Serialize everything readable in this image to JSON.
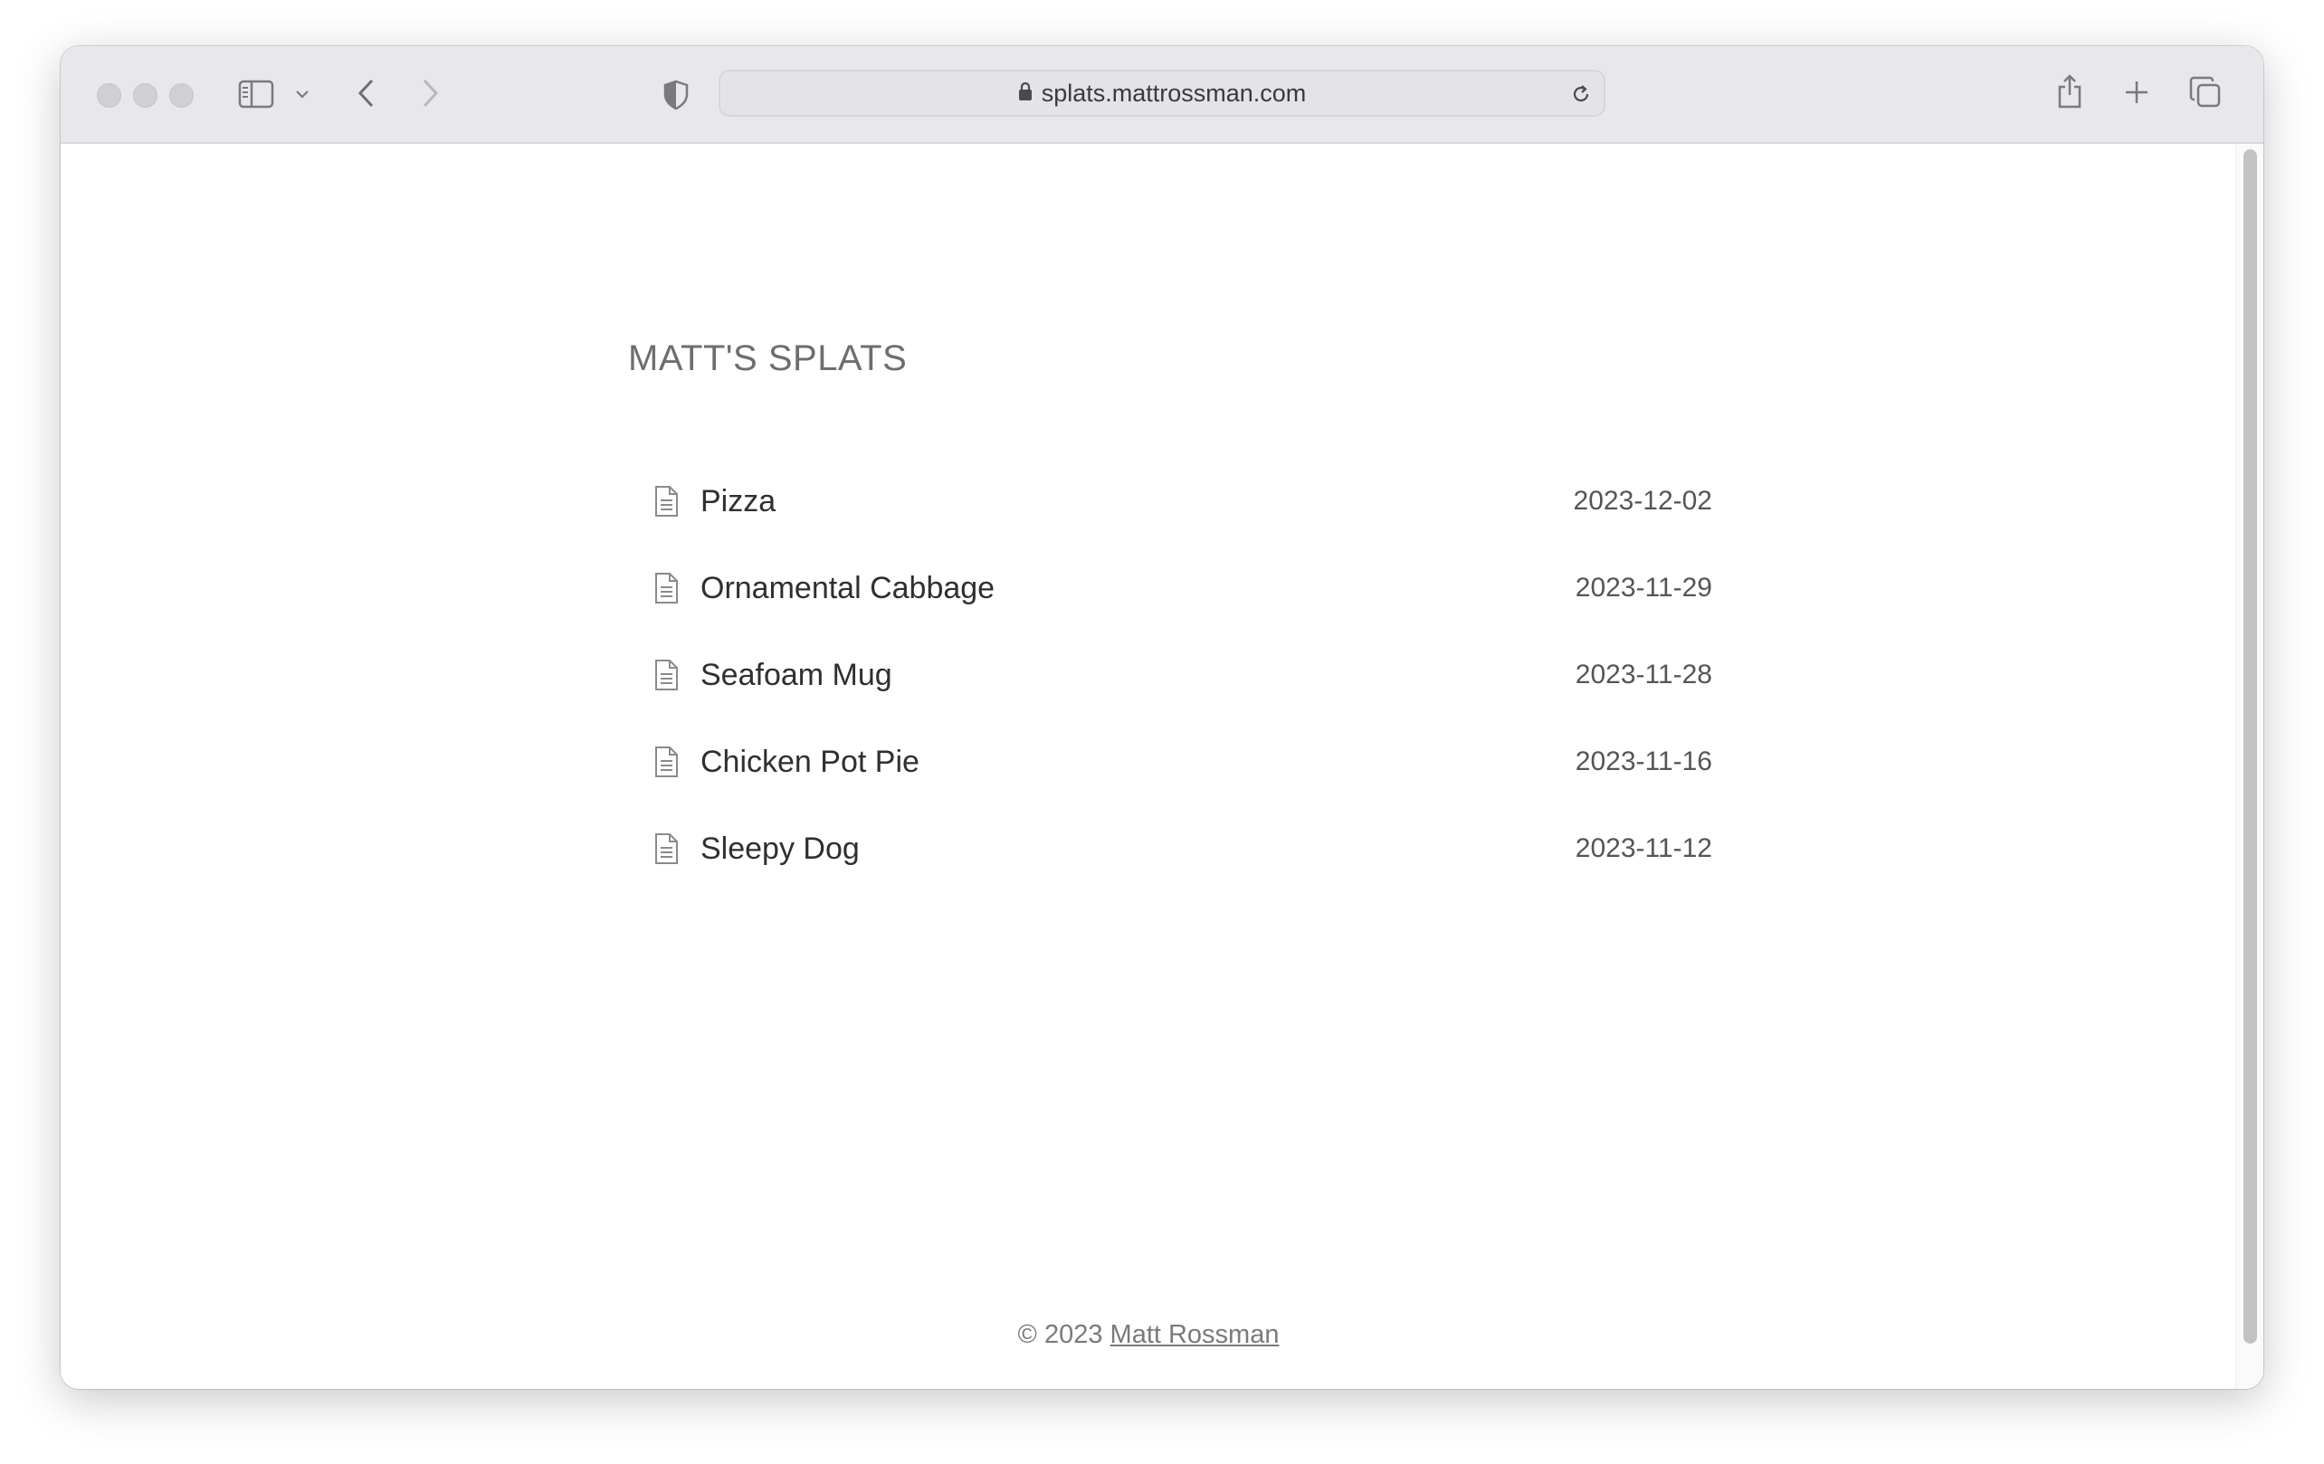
{
  "browser": {
    "url": "splats.mattrossman.com",
    "icons": {
      "close": "traffic-light-close",
      "minimize": "traffic-light-minimize",
      "zoom": "traffic-light-zoom",
      "sidebar": "sidebar-icon",
      "sidebar_menu": "chevron-down-icon",
      "back": "chevron-left-icon",
      "forward": "chevron-right-icon",
      "privacy": "shield-icon",
      "lock": "lock-icon",
      "reload": "reload-icon",
      "share": "share-icon",
      "new_tab": "plus-icon",
      "tabs": "tabs-overview-icon"
    }
  },
  "page": {
    "title": "MATT'S SPLATS",
    "posts": [
      {
        "title": "Pizza",
        "date": "2023-12-02"
      },
      {
        "title": "Ornamental Cabbage",
        "date": "2023-11-29"
      },
      {
        "title": "Seafoam Mug",
        "date": "2023-11-28"
      },
      {
        "title": "Chicken Pot Pie",
        "date": "2023-11-16"
      },
      {
        "title": "Sleepy Dog",
        "date": "2023-11-12"
      }
    ],
    "footer": {
      "copyright": "© 2023",
      "author_link": "Matt Rossman"
    }
  }
}
